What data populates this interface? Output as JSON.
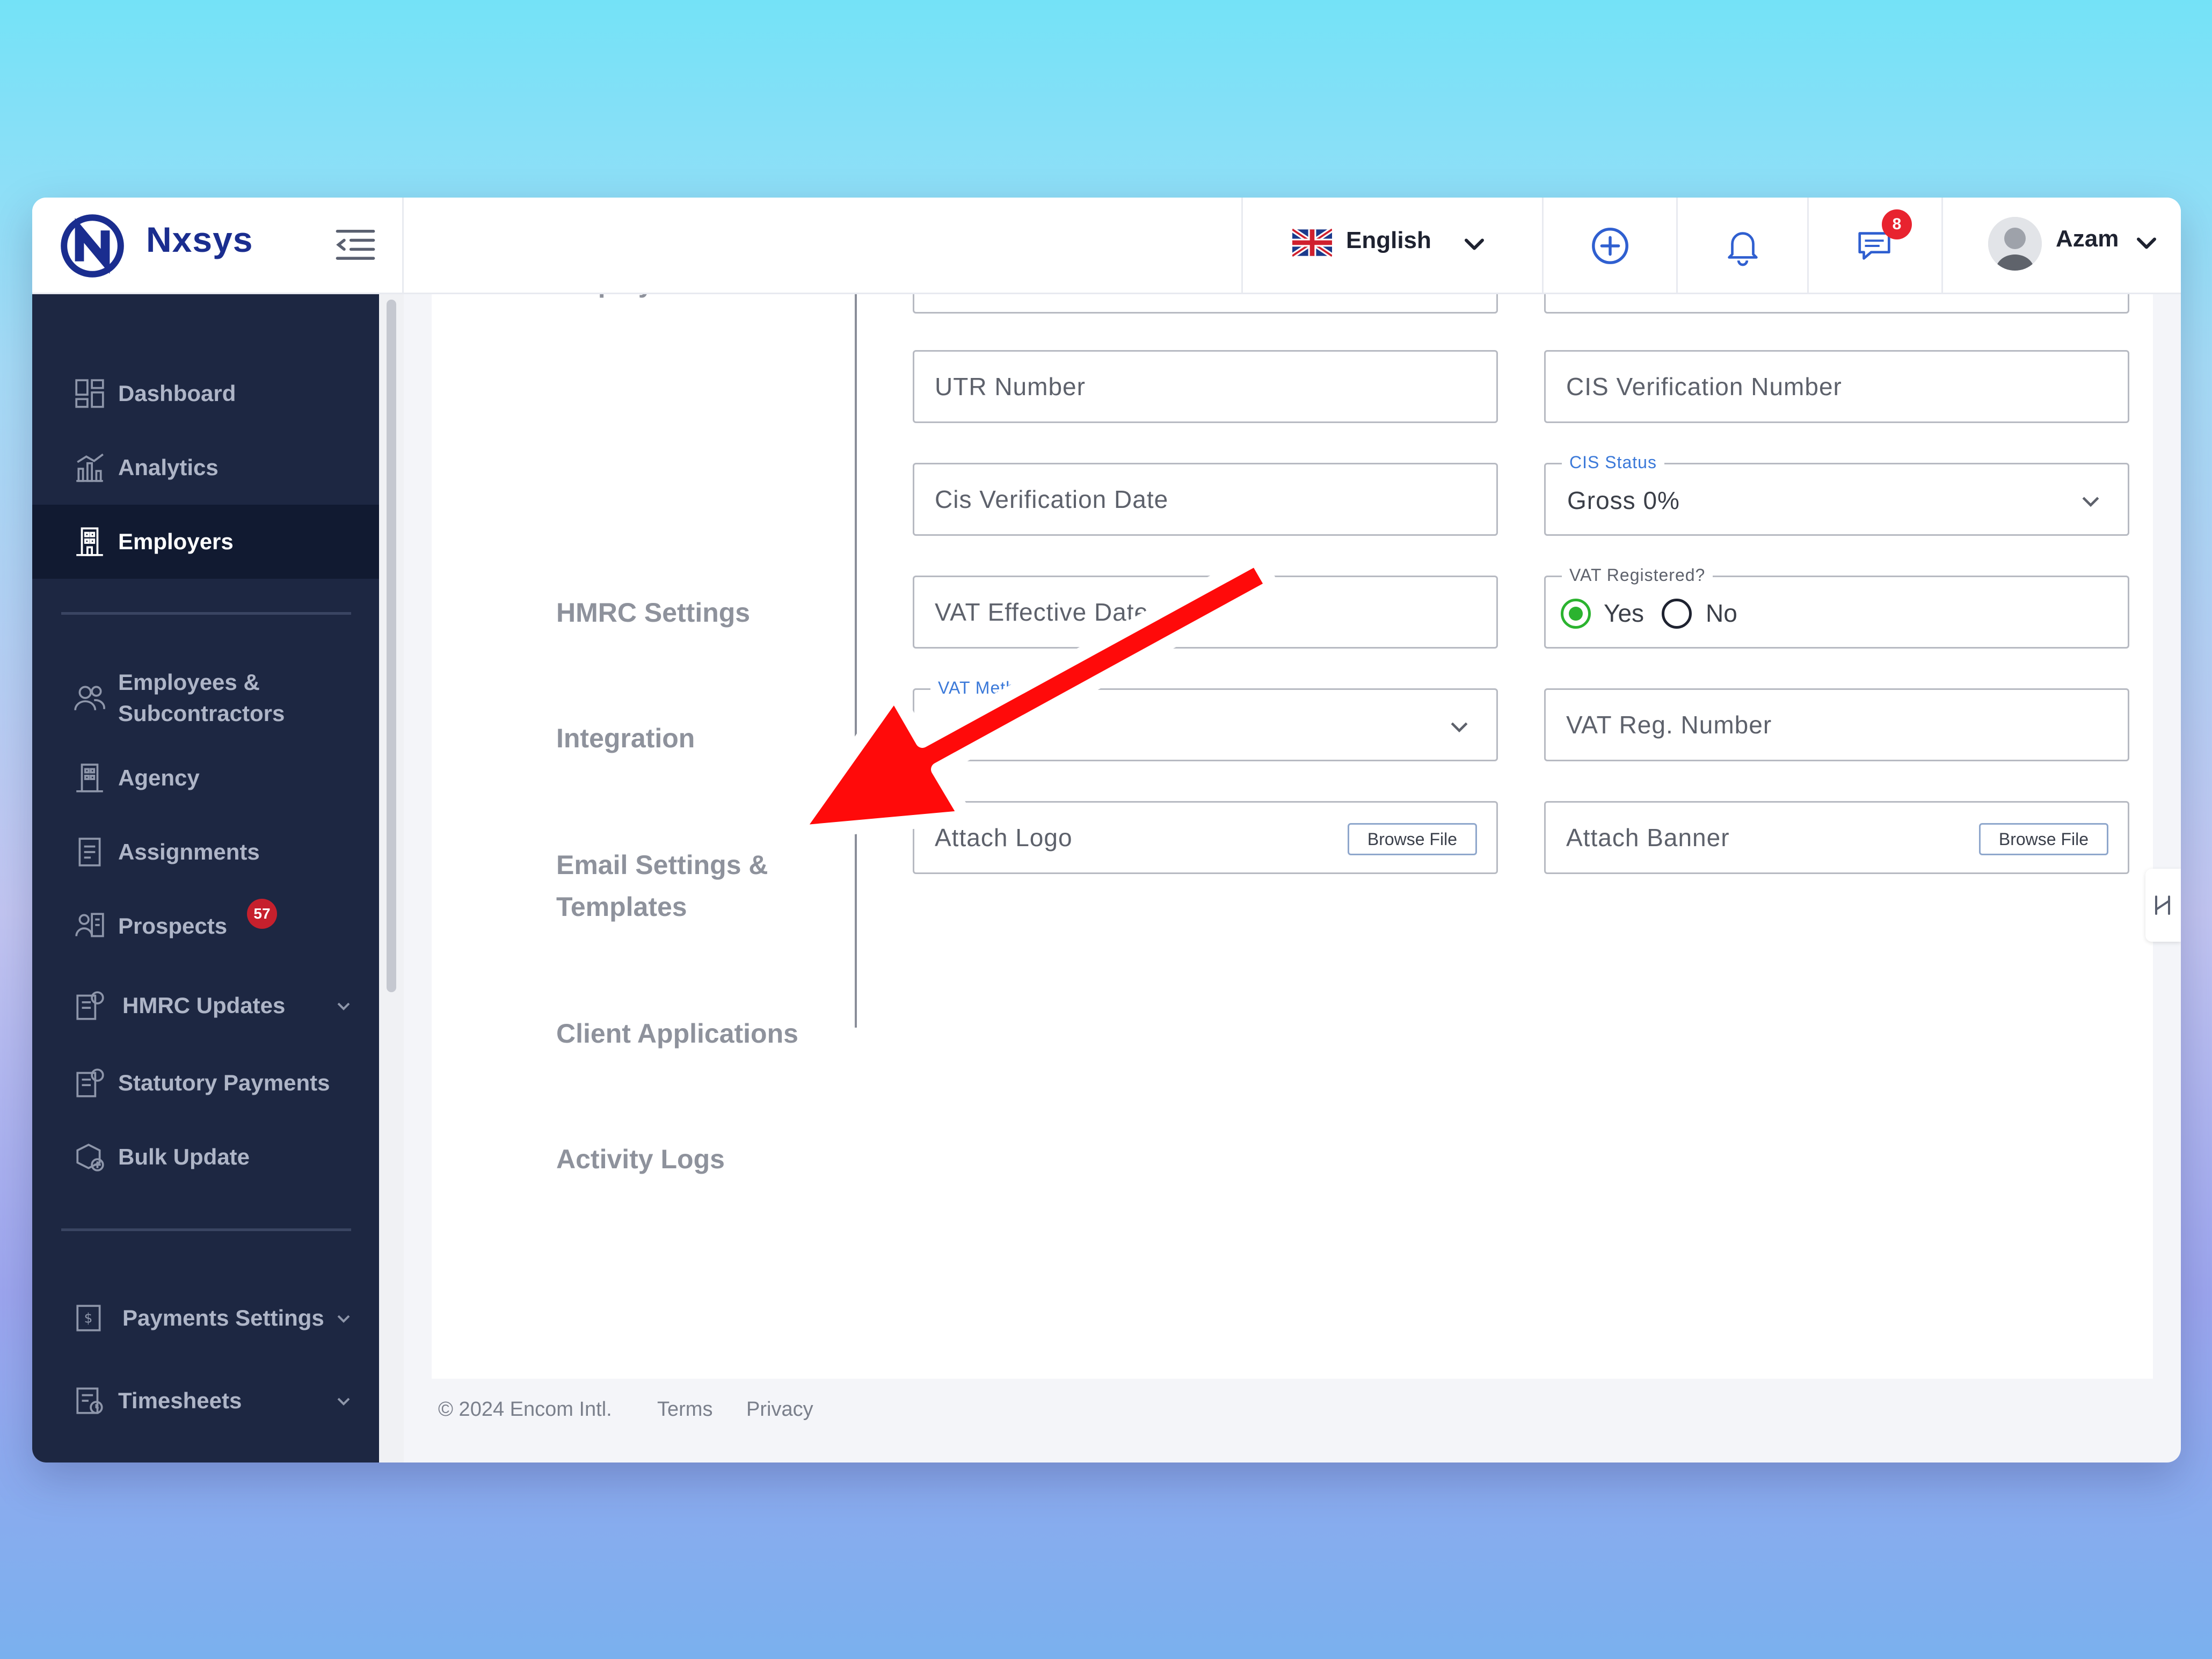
{
  "app": {
    "name": "Nxsys"
  },
  "header": {
    "language": "English",
    "notifications_badge": "8",
    "user_name": "Azam"
  },
  "sidebar": {
    "items": [
      {
        "label": "Dashboard"
      },
      {
        "label": "Analytics"
      },
      {
        "label": "Employers"
      },
      {
        "label": "Employees & Subcontractors"
      },
      {
        "label": "Agency"
      },
      {
        "label": "Assignments"
      },
      {
        "label": "Prospects",
        "badge": "57"
      },
      {
        "label": "HMRC Updates"
      },
      {
        "label": "Statutory Payments"
      },
      {
        "label": "Bulk Update"
      },
      {
        "label": "Payments Settings"
      },
      {
        "label": "Timesheets"
      }
    ],
    "active": "Employers"
  },
  "sections": {
    "items": [
      {
        "label": "Employer Defaults"
      },
      {
        "label": "HMRC Settings"
      },
      {
        "label": "Integration"
      },
      {
        "label": "Email Settings & Templates"
      },
      {
        "label": "Client Applications"
      },
      {
        "label": "Activity Logs"
      }
    ]
  },
  "form": {
    "utr_placeholder": "UTR Number",
    "cis_ver_number_placeholder": "CIS Verification Number",
    "cis_ver_date_placeholder": "Cis Verification Date",
    "cis_status_label": "CIS Status",
    "cis_status_value": "Gross 0%",
    "vat_effective_date_placeholder": "VAT Effective Date",
    "vat_registered_label": "VAT Registered?",
    "vat_registered_yes": "Yes",
    "vat_registered_no": "No",
    "vat_registered_selected": "Yes",
    "vat_method_label": "VAT Method",
    "vat_reg_number_placeholder": "VAT Reg. Number",
    "attach_logo_placeholder": "Attach Logo",
    "attach_banner_placeholder": "Attach Banner",
    "browse_label": "Browse File"
  },
  "footer": {
    "copyright": "© 2024 Encom Intl.",
    "terms": "Terms",
    "privacy": "Privacy"
  },
  "icons": {
    "logo": "nxsys-logo-icon",
    "menu": "menu-collapse-icon",
    "flag": "uk-flag-icon",
    "add": "plus-circle-icon",
    "bell": "bell-icon",
    "chat": "chat-icon",
    "annotation": "red-arrow-icon"
  },
  "colors": {
    "brand": "#1a2d8f",
    "sidebar": "#1d2742",
    "accent_blue": "#3b79d9",
    "radio_green": "#2bb32f",
    "badge_red": "#e8232f",
    "arrow_red": "#ff0a0a"
  }
}
